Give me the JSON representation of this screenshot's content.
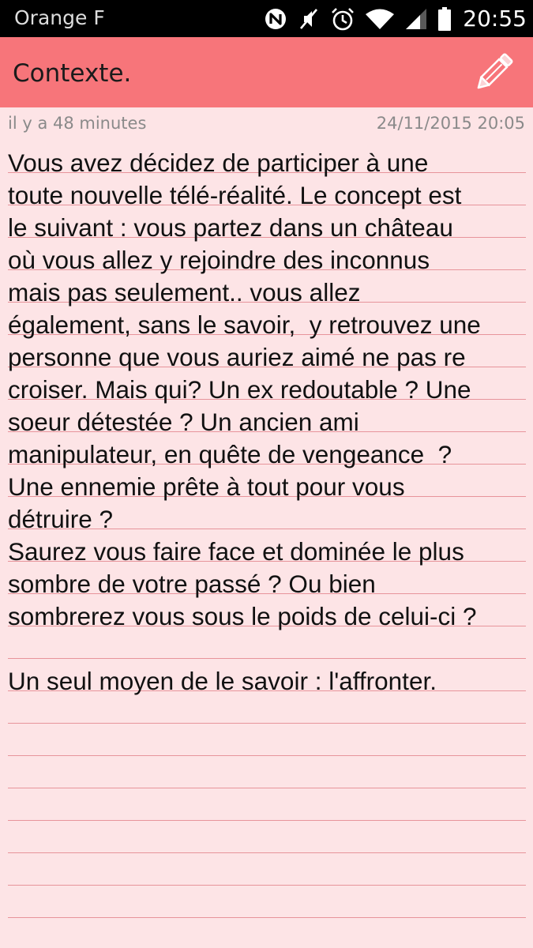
{
  "status_bar": {
    "carrier": "Orange F",
    "time": "20:55",
    "icons": [
      "nfc-icon",
      "mute-icon",
      "alarm-icon",
      "wifi-icon",
      "signal-icon",
      "battery-icon"
    ]
  },
  "app_bar": {
    "title": "Contexte.",
    "edit_icon": "pencil-icon",
    "color": "#f7757a"
  },
  "meta": {
    "relative_time": "il y a 48 minutes",
    "datetime": "24/11/2015 20:05"
  },
  "note": {
    "text": "Vous avez décidez de participer à une\ntoute nouvelle télé-réalité. Le concept est\nle suivant : vous partez dans un château\noù vous allez y rejoindre des inconnus\nmais pas seulement.. vous allez\négalement, sans le savoir,  y retrouvez une\npersonne que vous auriez aimé ne pas re\ncroiser. Mais qui? Un ex redoutable ? Une\nsoeur détestée ? Un ancien ami\nmanipulateur, en quête de vengeance  ?\nUne ennemie prête à tout pour vous\ndétruire ?\nSaurez vous faire face et dominée le plus\nsombre de votre passé ? Ou bien\nsombrerez vous sous le poids de celui-ci ?\n\nUn seul moyen de le savoir : l'affronter.",
    "background": "#fde4e6",
    "line_color": "#e7949b"
  }
}
